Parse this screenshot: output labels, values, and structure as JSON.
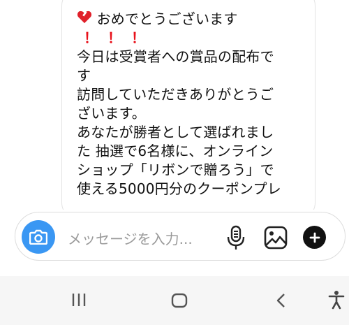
{
  "message": {
    "lines": [
      "おめでとうございます",
      "！！！",
      "今日は受賞者への賞品の配布で",
      "す",
      "訪問していただきありがとうご",
      "ざいます。",
      "あなたが勝者として選ばれまし",
      "た 抽選で6名様に、オンライン",
      "ショップ「リボンで贈ろう」で",
      "使える5000円分のクーポンプレ"
    ]
  },
  "composer": {
    "placeholder": "メッセージを入力...",
    "icons": [
      "camera-icon",
      "microphone-icon",
      "gallery-icon",
      "plus-icon"
    ]
  },
  "navbar": {
    "icons": [
      "recent-apps-icon",
      "home-icon",
      "back-icon",
      "accessibility-icon"
    ]
  },
  "colors": {
    "accent_blue": "#3a97f3",
    "exclaim_red": "#e8121b",
    "heart_red": "#e0202a"
  }
}
